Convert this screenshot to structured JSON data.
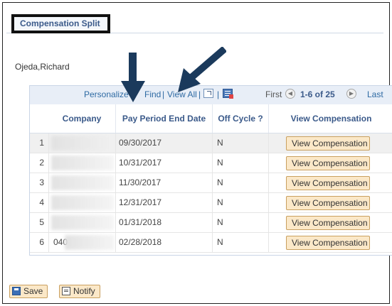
{
  "page": {
    "title": "Compensation Split",
    "employee_name": "Ojeda,Richard"
  },
  "grid": {
    "nav": {
      "personalize": "Personalize",
      "find": "Find",
      "view_all": "View All",
      "separator": "|",
      "first": "First",
      "count": "1-6 of 25",
      "last": "Last"
    },
    "columns": [
      "Company",
      "Pay Period End Date",
      "Off Cycle ?",
      "View Compensation"
    ],
    "rows": [
      {
        "num": "1",
        "company": "",
        "date": "09/30/2017",
        "off_cycle": "N",
        "button": "View Compensation"
      },
      {
        "num": "2",
        "company": "",
        "date": "10/31/2017",
        "off_cycle": "N",
        "button": "View Compensation"
      },
      {
        "num": "3",
        "company": "",
        "date": "11/30/2017",
        "off_cycle": "N",
        "button": "View Compensation"
      },
      {
        "num": "4",
        "company": "",
        "date": "12/31/2017",
        "off_cycle": "N",
        "button": "View Compensation"
      },
      {
        "num": "5",
        "company": "",
        "date": "01/31/2018",
        "off_cycle": "N",
        "button": "View Compensation"
      },
      {
        "num": "6",
        "company": "040",
        "date": "02/28/2018",
        "off_cycle": "N",
        "button": "View Compensation"
      }
    ]
  },
  "footer": {
    "save_label": "Save",
    "notify_label": "Notify"
  },
  "colors": {
    "accent_link": "#2e6aa3",
    "header_text": "#3b5a8a",
    "button_bg": "#fbe8c8",
    "annotation_arrow": "#1b3a5c"
  },
  "icons": [
    "zoom-grid-icon",
    "download-excel-icon",
    "previous-icon",
    "next-icon",
    "save-icon",
    "notify-icon",
    "annotation-arrow"
  ]
}
